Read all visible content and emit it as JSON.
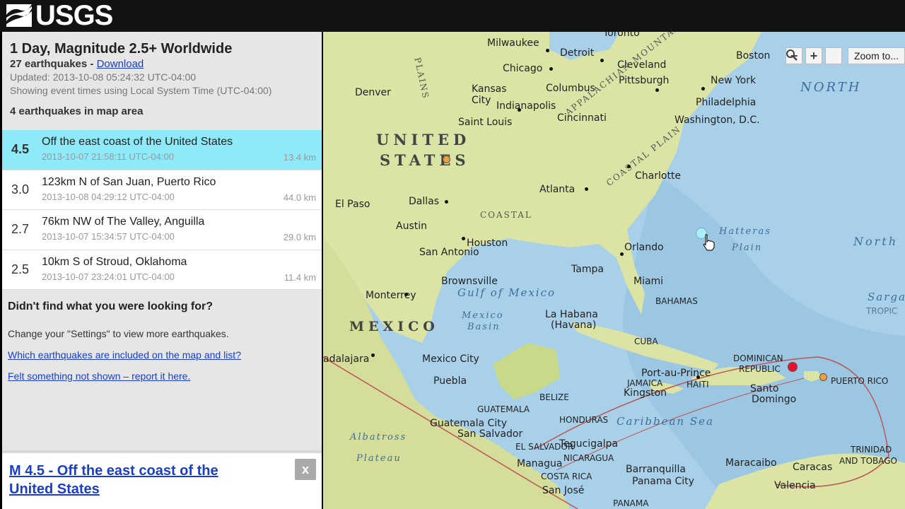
{
  "header": {
    "logo_text": "USGS"
  },
  "sidebar": {
    "title": "1 Day, Magnitude 2.5+ Worldwide",
    "count_text": "27 earthquakes - ",
    "download_label": "Download",
    "updated": "Updated: 2013-10-08 05:24:32 UTC-04:00",
    "time_note": "Showing event times using Local System Time (UTC-04:00)",
    "in_area": "4 earthquakes in map area",
    "earthquakes": [
      {
        "mag": "4.5",
        "place": "Off the east coast of the United States",
        "time": "2013-10-07 21:58:11 UTC-04:00",
        "depth": "13.4 km",
        "selected": true
      },
      {
        "mag": "3.0",
        "place": "123km N of San Juan, Puerto Rico",
        "time": "2013-10-08 04:29:12 UTC-04:00",
        "depth": "44.0 km",
        "selected": false
      },
      {
        "mag": "2.7",
        "place": "76km NW of The Valley, Anguilla",
        "time": "2013-10-07 15:34:57 UTC-04:00",
        "depth": "29.0 km",
        "selected": false
      },
      {
        "mag": "2.5",
        "place": "10km S of Stroud, Oklahoma",
        "time": "2013-10-07 23:24:01 UTC-04:00",
        "depth": "11.4 km",
        "selected": false
      }
    ],
    "help_title": "Didn't find what you were looking for?",
    "help_text": "Change your \"Settings\" to view more earthquakes.",
    "help_link1": "Which earthquakes are included on the map and list?",
    "help_link2": "Felt something not shown – report it here."
  },
  "popup": {
    "title": "M 4.5 - Off the east coast of the United States",
    "close_label": "x"
  },
  "map": {
    "controls": {
      "zoom_out": "−",
      "zoom_in": "+",
      "zoom_to": "Zoom to..."
    },
    "labels": {
      "toronto": "Toronto",
      "milwaukee": "Milwaukee",
      "detroit": "Detroit",
      "boston": "Boston",
      "chicago": "Chicago",
      "cleveland": "Cleveland",
      "new_york": "New York",
      "denver": "Denver",
      "kansas_city_1": "Kansas",
      "kansas_city_2": "City",
      "columbus": "Columbus",
      "pittsburgh": "Pittsburgh",
      "indianapolis": "Indianapolis",
      "philadelphia": "Philadelphia",
      "cincinnati": "Cincinnati",
      "washington": "Washington, D.C.",
      "saint_louis": "Saint Louis",
      "united": "UNITED",
      "states": "STATES",
      "charlotte": "Charlotte",
      "atlanta": "Atlanta",
      "el_paso": "El Paso",
      "dallas": "Dallas",
      "austin": "Austin",
      "houston": "Houston",
      "san_antonio": "San Antonio",
      "orlando": "Orlando",
      "tampa": "Tampa",
      "brownsville": "Brownsville",
      "miami": "Miami",
      "monterrey": "Monterrey",
      "gulf": "Gulf of Mexico",
      "mexico_basin_1": "Mexico",
      "mexico_basin_2": "Basin",
      "la_habana_1": "La Habana",
      "la_habana_2": "(Havana)",
      "bahamas": "BAHAMAS",
      "mexico": "MEXICO",
      "cuba": "CUBA",
      "guadalajara": "adalajara",
      "mexico_city": "Mexico City",
      "dominican_1": "DOMINICAN",
      "dominican_2": "REPUBLIC",
      "port_au_prince": "Port-au-Prince",
      "jamaica": "JAMAICA",
      "haiti": "HAITI",
      "puerto_rico": "PUERTO RICO",
      "kingston": "Kingston",
      "santo_1": "Santo",
      "santo_2": "Domingo",
      "puebla": "Puebla",
      "belize": "BELIZE",
      "guatemala": "GUATEMALA",
      "caribbean": "Caribbean Sea",
      "honduras": "HONDURAS",
      "guatemala_city": "Guatemala City",
      "san_salvador": "San Salvador",
      "el_salvador": "EL SALVADOR",
      "tegucigalpa": "Tegucigalpa",
      "albatross": "Albatross",
      "plateau": "Plateau",
      "managua": "Managua",
      "nicaragua": "NICARAGUA",
      "costa_rica": "COSTA RICA",
      "san_jose": "San José",
      "barranquilla": "Barranquilla",
      "panama_city": "Panama City",
      "panama": "PANAMA",
      "maracaibo": "Maracaibo",
      "caracas": "Caracas",
      "valencia": "Valencia",
      "trinidad_1": "TRINIDAD",
      "trinidad_2": "AND TOBAGO",
      "north_1": "NORTH",
      "north_2": "North",
      "hatteras_1": "Hatteras",
      "hatteras_2": "Plain",
      "sargasso": "Sarga",
      "tropic": "TROPIC",
      "appalachian": "APPALACHIAN MOUNTAINS",
      "coastal_plain_1": "COASTAL PLAIN",
      "coastal_plain_2": "COASTAL",
      "plains": "PLAINS"
    },
    "colors": {
      "water": "#a9d0e9",
      "land": "#dbe3a5",
      "selected_row": "#8ee9f8",
      "marker_red": "#e8102a",
      "marker_orange": "#f2a03a"
    }
  }
}
